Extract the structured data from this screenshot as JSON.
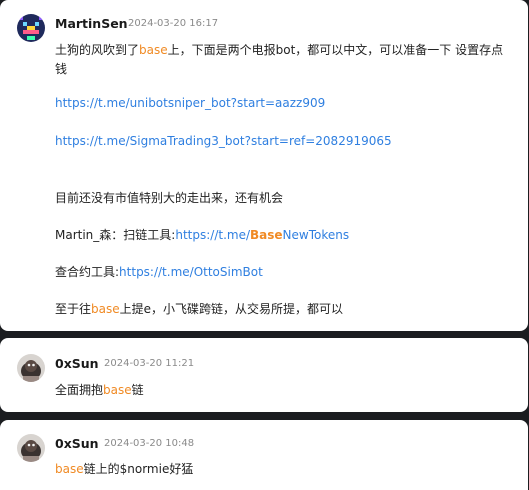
{
  "messages": [
    {
      "user": "MartinSen",
      "time": "2024-03-20 16:17",
      "lines": {
        "l1a": "土狗的风吹到了",
        "l1b": "base",
        "l1c": "上，下面是两个电报bot，都可以中文，可以准备一下 设置存点",
        "l2": "钱",
        "l3": "https://t.me/unibotsniper_bot?start=aazz909",
        "l4": "https://t.me/SigmaTrading3_bot?start=ref=2082919065",
        "l5": "目前还没有市值特别大的走出来，还有机会",
        "l6a": "Martin_森：扫链工具:",
        "l6b": "https://t.me/",
        "l6c": "Base",
        "l6d": "NewTokens",
        "l7a": "查合约工具:",
        "l7b": "https://t.me/OttoSimBot",
        "l8a": "至于往",
        "l8b": "base",
        "l8c": "上提e，小飞碟跨链，从交易所提，都可以"
      }
    },
    {
      "user": "0xSun",
      "time": "2024-03-20 11:21",
      "lines": {
        "a": "全面拥抱",
        "b": "base",
        "c": "链"
      }
    },
    {
      "user": "0xSun",
      "time": "2024-03-20 10:48",
      "lines": {
        "a": "base",
        "b": "链上的$normie好猛"
      }
    }
  ],
  "colors": {
    "highlight": "#f08a24",
    "link": "#2f7fe0",
    "background": "#1b1d20"
  }
}
